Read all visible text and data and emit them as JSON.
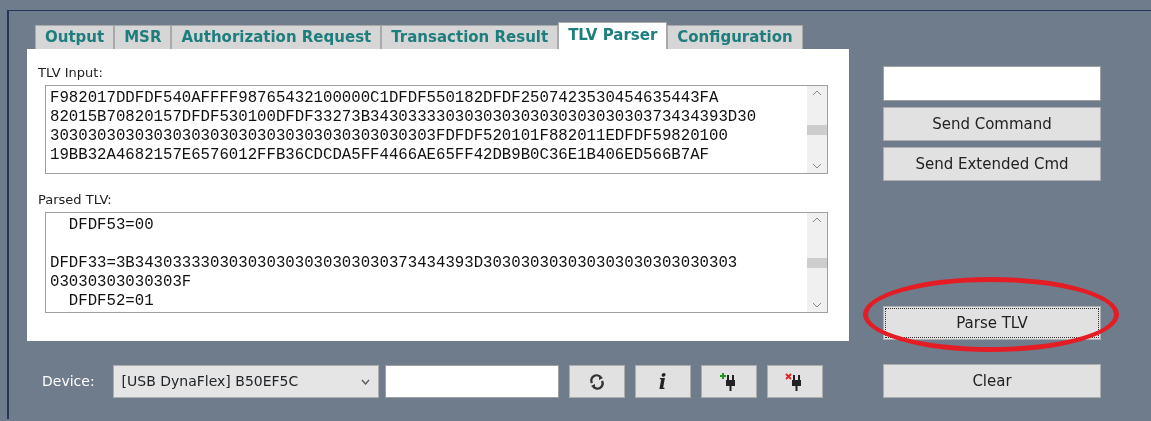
{
  "tabs": [
    {
      "label": "Output",
      "selected": false
    },
    {
      "label": "MSR",
      "selected": false
    },
    {
      "label": "Authorization Request",
      "selected": false
    },
    {
      "label": "Transaction Result",
      "selected": false
    },
    {
      "label": "TLV Parser",
      "selected": true
    },
    {
      "label": "Configuration",
      "selected": false
    }
  ],
  "tlv_input": {
    "label": "TLV Input:",
    "lines": [
      "F982017DDFDF540AFFFF98765432100000C1DFDF550182DFDF2507423530454635443FA",
      "82015B70820157DFDF530100DFDF33273B34303333030303030303030303030373434393D30",
      "30303030303030303030303030303030303030303FDFDF520101F882011EDFDF59820100",
      "19BB32A4682157E6576012FFB36CDCDA5FF4466AE65FF42DB9B0C36E1B406ED566B7AF"
    ]
  },
  "parsed_tlv": {
    "label": "Parsed TLV:",
    "blocks": [
      [
        "  DFDF53=00"
      ],
      [
        "DFDF33=3B343033330303030303030303030373434393D303030303030303030303030303",
        "03030303030303F",
        "  DFDF52=01"
      ]
    ]
  },
  "device": {
    "label": "Device:",
    "value": "[USB DynaFlex] B50EF5C"
  },
  "device_buttons": [
    {
      "kind": "refresh"
    },
    {
      "kind": "info",
      "text": "i"
    },
    {
      "kind": "connect"
    },
    {
      "kind": "disconnect"
    }
  ],
  "command_buttons": [
    "Send Command",
    "Send Extended Cmd"
  ],
  "parse_button": {
    "label": "Parse TLV",
    "highlighted": true
  },
  "clear_button": "Clear"
}
